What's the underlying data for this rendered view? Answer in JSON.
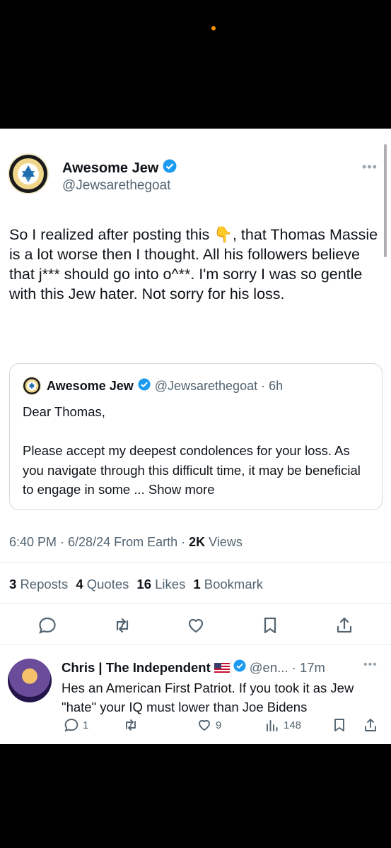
{
  "tweet": {
    "author_name": "Awesome Jew",
    "author_handle": "@Jewsarethegoat",
    "text": "So I realized after posting this 👇, that Thomas Massie is a lot worse then I thought. All his followers believe that j*** should go into o^**. I'm sorry I was so gentle with this Jew hater. Not sorry for his loss.",
    "more_label": "•••",
    "timestamp": "6:40 PM · 6/28/24 From Earth · ",
    "views_count": "2K",
    "views_label": " Views"
  },
  "quote": {
    "author_name": "Awesome Jew",
    "meta": "@Jewsarethegoat · 6h",
    "line1": "Dear Thomas,",
    "line2": "Please accept my deepest condolences for your loss. As you navigate through this difficult time, it may be beneficial to engage in some ... ",
    "show_more": "Show more"
  },
  "stats": {
    "reposts_count": "3",
    "reposts_label": "Reposts",
    "quotes_count": "4",
    "quotes_label": "Quotes",
    "likes_count": "16",
    "likes_label": "Likes",
    "bookmarks_count": "1",
    "bookmarks_label": "Bookmark"
  },
  "actions": [
    "reply-icon",
    "repost-icon",
    "like-icon",
    "bookmark-icon",
    "share-icon"
  ],
  "reply": {
    "author_name": "Chris | The Independent",
    "meta": "@en... · 17m",
    "more_label": "•••",
    "text": "Hes an American First Patriot. If you took it as Jew \"hate\" your IQ must lower than Joe Bidens",
    "replies": "1",
    "likes": "9",
    "views": "148"
  },
  "colors": {
    "verified": "#1d9bf0",
    "secondary_text": "#536471",
    "icon": "#536471",
    "accent_dot": "#ff9500"
  }
}
